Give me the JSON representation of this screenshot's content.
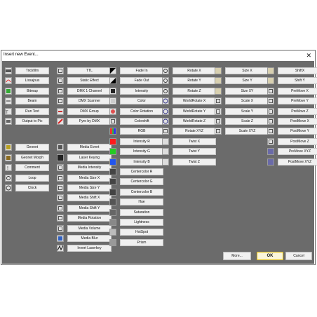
{
  "window": {
    "title": "Insert new Event...",
    "close_glyph": "✕"
  },
  "footer": {
    "more_label": "More...",
    "ok_label": "OK",
    "cancel_label": "Cancel"
  },
  "columns": [
    {
      "groups": [
        [
          {
            "label": "Trickfilm",
            "icon": "trickfilm-icon"
          },
          {
            "label": "Lissajous",
            "icon": "lissajous-icon"
          },
          {
            "label": "Bitmap",
            "icon": "bitmap-icon"
          },
          {
            "label": "Beam",
            "icon": "beam-icon"
          },
          {
            "label": "Run Text",
            "icon": "run-text-icon"
          },
          {
            "label": "Output to Pic",
            "icon": "output-pic-icon"
          }
        ],
        [
          {
            "label": "Geonet",
            "icon": "geonet-icon"
          },
          {
            "label": "Geonet Morph",
            "icon": "geonet-morph-icon"
          },
          {
            "label": "Comment",
            "icon": "comment-icon"
          },
          {
            "label": "Loop",
            "icon": "loop-icon"
          },
          {
            "label": "Clock",
            "icon": "clock-icon"
          }
        ]
      ]
    },
    {
      "groups": [
        [
          {
            "label": "TTL",
            "icon": "ttl-icon"
          },
          {
            "label": "Static Effect",
            "icon": "static-effect-icon"
          },
          {
            "label": "DMX 1 Channel",
            "icon": "dmx-channel-icon"
          },
          {
            "label": "DMX Scanner",
            "icon": "dmx-scanner-icon"
          },
          {
            "label": "DMX Group",
            "icon": "dmx-group-icon"
          },
          {
            "label": "Pyro by DMX",
            "icon": "pyro-icon"
          }
        ],
        [
          {
            "label": "Media Event",
            "icon": "media-event-icon"
          },
          {
            "label": "Laser Keying",
            "icon": "laser-keying-icon"
          },
          {
            "label": "Media Intensity",
            "icon": "media-intensity-icon"
          },
          {
            "label": "Media Size X",
            "icon": "media-size-x-icon"
          },
          {
            "label": "Media Size Y",
            "icon": "media-size-y-icon"
          },
          {
            "label": "Media Shift X",
            "icon": "media-shift-x-icon"
          },
          {
            "label": "Media Shift Y",
            "icon": "media-shift-y-icon"
          },
          {
            "label": "Media Rotation",
            "icon": "media-rotation-icon"
          },
          {
            "label": "Media Volume",
            "icon": "media-volume-icon"
          },
          {
            "label": "Media Blur",
            "icon": "media-blur-icon"
          },
          {
            "label": "Invert Laserkey",
            "icon": "invert-laserkey-icon"
          }
        ]
      ]
    },
    {
      "groups": [
        [
          {
            "label": "Fade In",
            "icon": "fade-in-icon"
          },
          {
            "label": "Fade Out",
            "icon": "fade-out-icon"
          },
          {
            "label": "Intensity",
            "icon": "intensity-icon"
          },
          {
            "label": "Color",
            "icon": "color-icon"
          },
          {
            "label": "Color Rotation",
            "icon": "color-rotation-icon"
          },
          {
            "label": "Colorshift",
            "icon": "colorshift-icon"
          },
          {
            "label": "RGB",
            "icon": "rgb-icon"
          },
          {
            "label": "Intensity R",
            "icon": "intensity-r-icon"
          },
          {
            "label": "Intensity G",
            "icon": "intensity-g-icon"
          },
          {
            "label": "Intensity B",
            "icon": "intensity-b-icon"
          },
          {
            "label": "Centercolor R",
            "icon": "centercolor-r-icon"
          },
          {
            "label": "Centercolor G",
            "icon": "centercolor-g-icon"
          },
          {
            "label": "Centercolor B",
            "icon": "centercolor-b-icon"
          },
          {
            "label": "Hue",
            "icon": "hue-icon"
          },
          {
            "label": "Saturation",
            "icon": "saturation-icon"
          },
          {
            "label": "Lightness",
            "icon": "lightness-icon"
          },
          {
            "label": "HotSpot",
            "icon": "hotspot-icon"
          },
          {
            "label": "Prism",
            "icon": "prism-icon"
          }
        ]
      ]
    },
    {
      "groups": [
        [
          {
            "label": "Rotate X",
            "icon": "rotate-x-icon"
          },
          {
            "label": "Rotate Y",
            "icon": "rotate-y-icon"
          },
          {
            "label": "Rotate Z",
            "icon": "rotate-z-icon"
          },
          {
            "label": "WorldRotate X",
            "icon": "world-rotate-x-icon"
          },
          {
            "label": "WorldRotate Y",
            "icon": "world-rotate-y-icon"
          },
          {
            "label": "WorldRotate Z",
            "icon": "world-rotate-z-icon"
          },
          {
            "label": "Rotate XYZ",
            "icon": "rotate-xyz-icon"
          },
          {
            "label": "Twist X",
            "icon": "twist-x-icon"
          },
          {
            "label": "Twist Y",
            "icon": "twist-y-icon"
          },
          {
            "label": "Twist Z",
            "icon": "twist-z-icon"
          }
        ]
      ]
    },
    {
      "groups": [
        [
          {
            "label": "Size X",
            "icon": "size-x-icon"
          },
          {
            "label": "Size Y",
            "icon": "size-y-icon"
          },
          {
            "label": "Size XY",
            "icon": "size-xy-icon"
          },
          {
            "label": "Scale X",
            "icon": "scale-x-icon"
          },
          {
            "label": "Scale Y",
            "icon": "scale-y-icon"
          },
          {
            "label": "Scale Z",
            "icon": "scale-z-icon"
          },
          {
            "label": "Scale XYZ",
            "icon": "scale-xyz-icon"
          }
        ]
      ]
    },
    {
      "groups": [
        [
          {
            "label": "ShiftX",
            "icon": "shift-x-icon"
          },
          {
            "label": "Shift Y",
            "icon": "shift-y-icon"
          },
          {
            "label": "PreMove X",
            "icon": "premove-x-icon"
          },
          {
            "label": "PreMove Y",
            "icon": "premove-y-icon"
          },
          {
            "label": "PreMove Z",
            "icon": "premove-z-icon"
          },
          {
            "label": "PostMove X",
            "icon": "postmove-x-icon"
          },
          {
            "label": "PostMove Y",
            "icon": "postmove-y-icon"
          },
          {
            "label": "PostMove Z",
            "icon": "postmove-z-icon"
          },
          {
            "label": "PreMove XYZ",
            "icon": "premove-xyz-icon"
          },
          {
            "label": "PostMove XYZ",
            "icon": "postmove-xyz-icon"
          }
        ]
      ]
    }
  ]
}
